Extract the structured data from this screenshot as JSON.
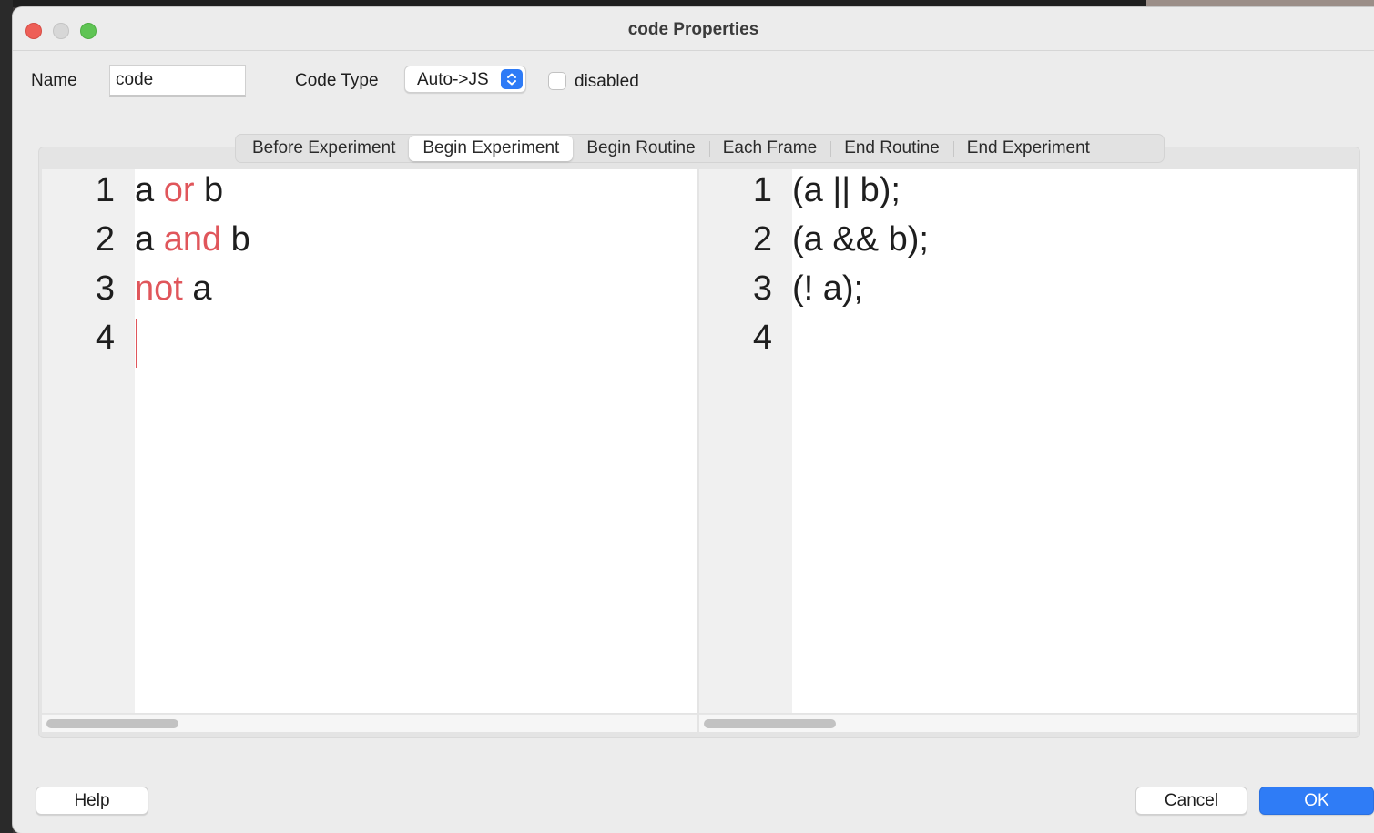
{
  "window": {
    "title": "code Properties"
  },
  "form": {
    "name_label": "Name",
    "name_value": "code",
    "code_type_label": "Code Type",
    "code_type_value": "Auto->JS",
    "disabled_label": "disabled",
    "disabled_checked": false
  },
  "tabs": [
    {
      "label": "Before Experiment",
      "active": false
    },
    {
      "label": "Begin Experiment",
      "active": true
    },
    {
      "label": "Begin Routine",
      "active": false
    },
    {
      "label": "Each Frame",
      "active": false
    },
    {
      "label": "End Routine",
      "active": false
    },
    {
      "label": "End Experiment",
      "active": false
    }
  ],
  "python_editor": {
    "lines": [
      {
        "num": "1",
        "parts": [
          {
            "t": "a ",
            "kw": false
          },
          {
            "t": "or",
            "kw": true
          },
          {
            "t": " b",
            "kw": false
          }
        ]
      },
      {
        "num": "2",
        "parts": [
          {
            "t": "a ",
            "kw": false
          },
          {
            "t": "and",
            "kw": true
          },
          {
            "t": " b",
            "kw": false
          }
        ]
      },
      {
        "num": "3",
        "parts": [
          {
            "t": "not",
            "kw": true
          },
          {
            "t": " a",
            "kw": false
          }
        ]
      },
      {
        "num": "4",
        "parts": []
      }
    ]
  },
  "js_editor": {
    "lines": [
      {
        "num": "1",
        "text": "(a || b);"
      },
      {
        "num": "2",
        "text": "(a && b);"
      },
      {
        "num": "3",
        "text": "(! a);"
      },
      {
        "num": "4",
        "text": ""
      }
    ]
  },
  "buttons": {
    "help": "Help",
    "cancel": "Cancel",
    "ok": "OK"
  },
  "colors": {
    "keyword": "#e0565b",
    "accent": "#2f7cf6",
    "close": "#ee5f57",
    "maximize": "#5fc454"
  },
  "icons": {
    "select_arrows": "chevron-up-down-icon"
  }
}
